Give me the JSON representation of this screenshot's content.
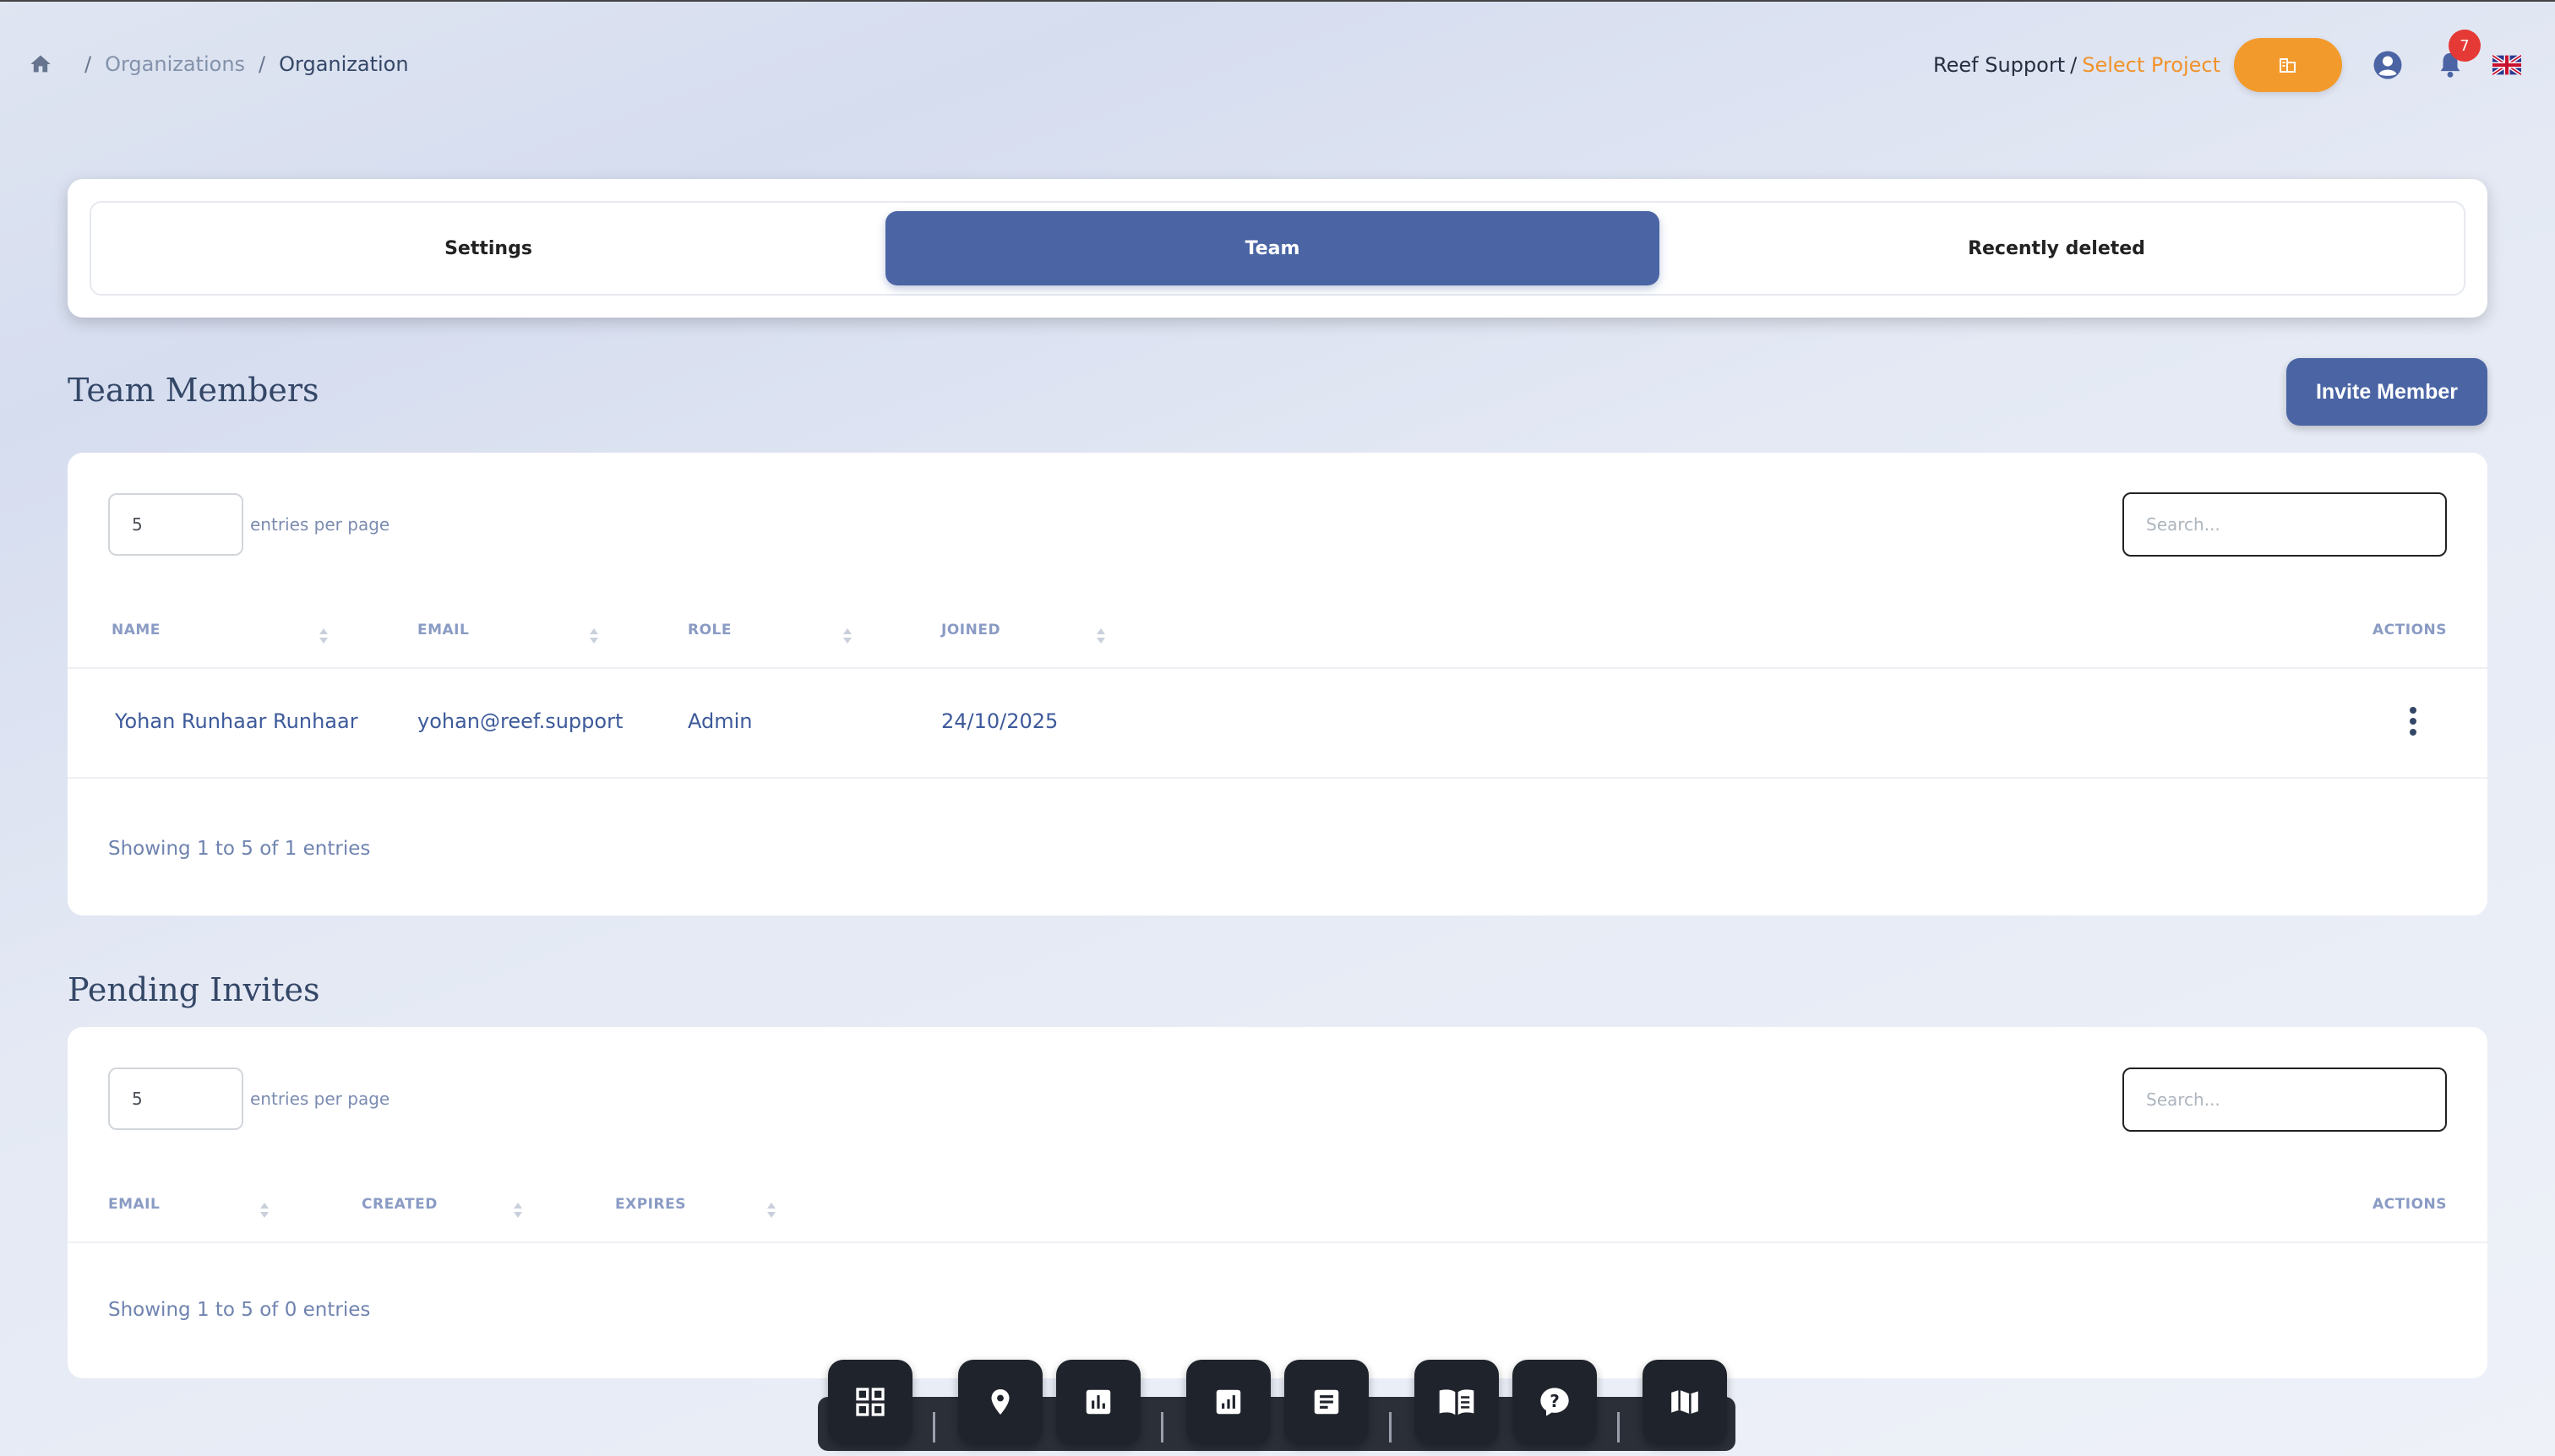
{
  "breadcrumb": {
    "home_icon": "home-icon",
    "items": [
      "Organizations",
      "Organization"
    ]
  },
  "topbar": {
    "context_label": "Reef Support",
    "context_separator": "/",
    "project_label": "Select Project",
    "org_button_icon": "building-icon",
    "account_icon": "user-circle-icon",
    "notification_icon": "bell-icon",
    "notification_count": "7",
    "language_icon": "uk-flag-icon"
  },
  "tabs": [
    {
      "label": "Settings",
      "active": false
    },
    {
      "label": "Team",
      "active": true
    },
    {
      "label": "Recently deleted",
      "active": false
    }
  ],
  "team": {
    "title": "Team Members",
    "invite_label": "Invite Member",
    "entries_value": "5",
    "entries_label": "entries per page",
    "search_placeholder": "Search...",
    "columns": [
      "NAME",
      "EMAIL",
      "ROLE",
      "JOINED",
      "ACTIONS"
    ],
    "rows": [
      {
        "name": "Yohan Runhaar Runhaar",
        "email": "yohan@reef.support",
        "role": "Admin",
        "joined": "24/10/2025"
      }
    ],
    "footer": "Showing 1 to 5 of 1 entries"
  },
  "invites": {
    "title": "Pending Invites",
    "entries_value": "5",
    "entries_label": "entries per page",
    "search_placeholder": "Search...",
    "columns": [
      "EMAIL",
      "CREATED",
      "EXPIRES",
      "ACTIONS"
    ],
    "footer": "Showing 1 to 5 of 0 entries"
  },
  "dock": [
    "dashboard-icon",
    "location-pin-icon",
    "bar-chart-icon",
    "analytics-icon",
    "document-icon",
    "book-icon",
    "help-icon",
    "map-icon"
  ],
  "colors": {
    "primary": "#4a64a4",
    "accent_orange": "#f39a2d",
    "badge_red": "#e53935"
  }
}
